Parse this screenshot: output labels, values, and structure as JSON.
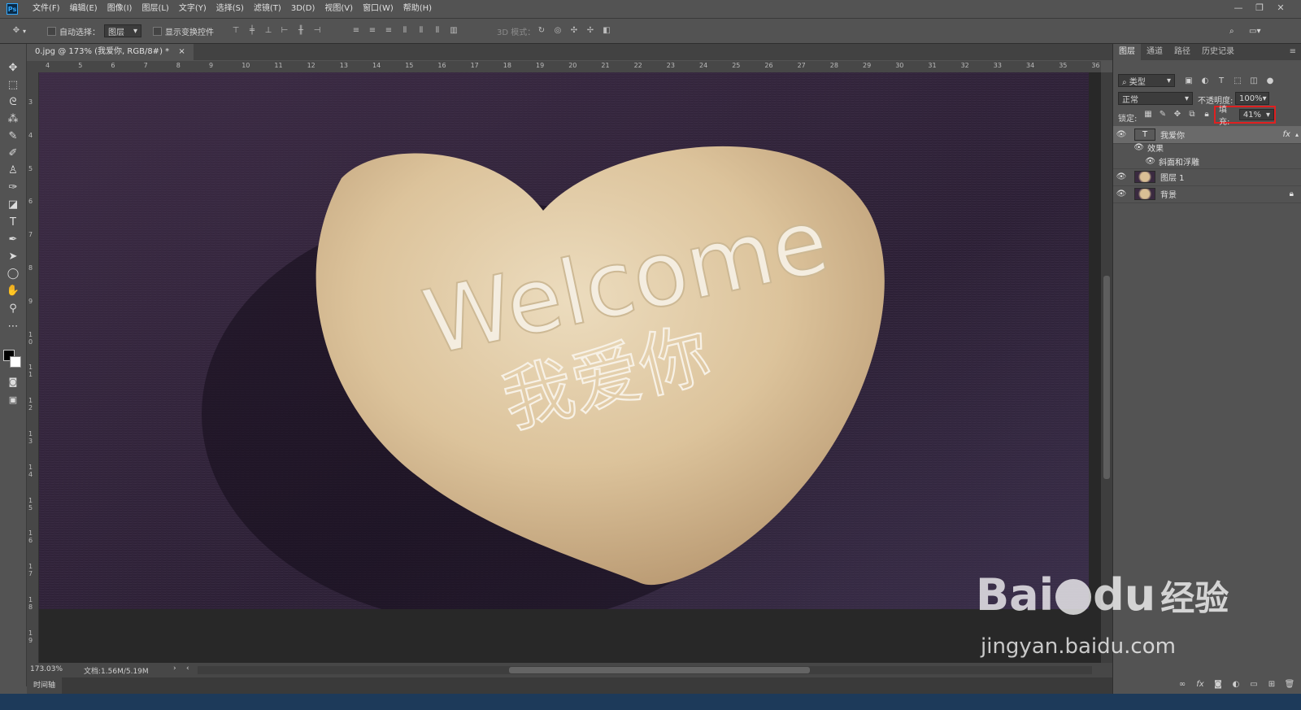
{
  "app": {
    "logo": "Ps"
  },
  "menu": [
    "文件(F)",
    "编辑(E)",
    "图像(I)",
    "图层(L)",
    "文字(Y)",
    "选择(S)",
    "滤镜(T)",
    "3D(D)",
    "视图(V)",
    "窗口(W)",
    "帮助(H)"
  ],
  "window_controls": [
    "—",
    "❐",
    "✕"
  ],
  "options": {
    "auto_select_label": "自动选择：",
    "auto_select_value": "图层",
    "show_transform_label": "显示变换控件",
    "mode_3d_label": "3D 模式："
  },
  "document": {
    "tab_title": "0.jpg @ 173% (我爱你, RGB/8#) *",
    "tab_close": "×",
    "ruler_top": [
      "4",
      "5",
      "6",
      "7",
      "8",
      "9",
      "10",
      "11",
      "12",
      "13",
      "14",
      "15",
      "16",
      "17",
      "18",
      "19",
      "20",
      "21",
      "22",
      "23",
      "24",
      "25",
      "26",
      "27",
      "28",
      "29",
      "30",
      "31",
      "32",
      "33",
      "34",
      "35",
      "36"
    ],
    "ruler_left": [
      "3",
      "4",
      "5",
      "6",
      "7",
      "8",
      "9",
      "1 0",
      "1 1",
      "1 2",
      "1 3",
      "1 4",
      "1 5",
      "1 6",
      "1 7",
      "1 8",
      "1 9",
      "2"
    ],
    "canvas_text": {
      "welcome": "Welcome",
      "chinese": "我爱你"
    }
  },
  "status": {
    "zoom": "173.03%",
    "doc_info": "文档:1.56M/5.19M"
  },
  "timeline": {
    "label": "时间轴"
  },
  "panel": {
    "tabs": [
      "图层",
      "通道",
      "路径",
      "历史记录"
    ],
    "filter_label": "类型",
    "blend_mode": "正常",
    "opacity_label": "不透明度:",
    "opacity_value": "100%",
    "lock_label": "锁定:",
    "fill_label": "填充:",
    "fill_value": "41%",
    "layers": [
      {
        "name": "我爱你",
        "kind": "text",
        "fx": "fx"
      },
      {
        "name": "效果",
        "kind": "effects"
      },
      {
        "name": "斜面和浮雕",
        "kind": "effect"
      },
      {
        "name": "图层 1",
        "kind": "image"
      },
      {
        "name": "背景",
        "kind": "image",
        "locked": true
      }
    ],
    "footer_icons": [
      "link-icon",
      "fx-icon",
      "mask-icon",
      "adjustment-icon",
      "folder-icon",
      "new-layer-icon",
      "trash-icon"
    ]
  },
  "watermark": {
    "brand": "Bai",
    "brand2": "du",
    "cn": "经验",
    "url": "jingyan.baidu.com"
  },
  "colors": {
    "highlight": "#e02020",
    "accent": "#31a8ff",
    "stone": "#d9bf95",
    "bg_fabric": "#2a1f30"
  }
}
